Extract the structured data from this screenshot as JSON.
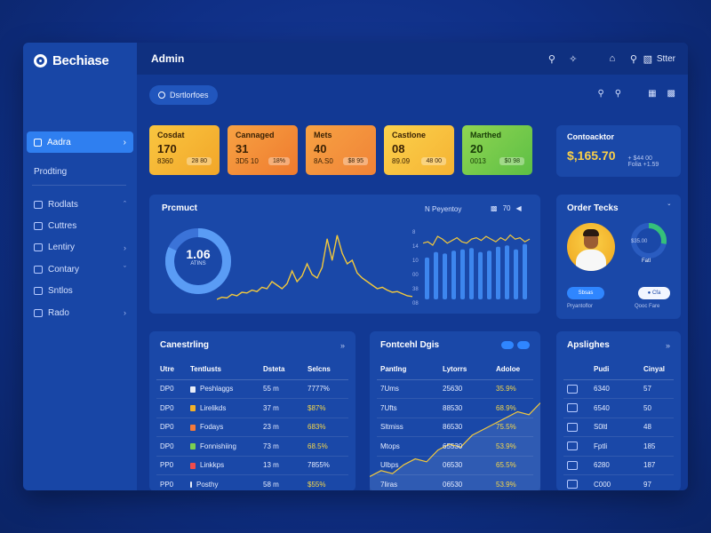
{
  "app": {
    "brand": "Bechiase",
    "title": "Admin"
  },
  "header": {
    "tools": [
      "search-icon",
      "sparkle-icon",
      "home-icon",
      "search-icon"
    ],
    "user": "Stter"
  },
  "sidebar": {
    "active": "Aadra",
    "plain": "Prodting",
    "items": [
      {
        "label": "Rodlats",
        "icon": "box-icon"
      },
      {
        "label": "Cuttres",
        "icon": "grid-icon"
      },
      {
        "label": "Lentiry",
        "icon": "list-icon"
      },
      {
        "label": "Contary",
        "icon": "chat-icon"
      },
      {
        "label": "Sntlos",
        "icon": "settings-icon"
      },
      {
        "label": "Rado",
        "icon": "shield-icon"
      }
    ]
  },
  "subheader": {
    "pill": "Dsrtlorfoes"
  },
  "stats": [
    {
      "name": "Cosdat",
      "value": "170",
      "sub": "8360",
      "chip": "28 80"
    },
    {
      "name": "Cannaged",
      "value": "31",
      "sub": "3D5 10",
      "chip": "18%"
    },
    {
      "name": "Mets",
      "value": "40",
      "sub": "8A.S0",
      "chip": "$8 95"
    },
    {
      "name": "Castlone",
      "value": "08",
      "sub": "89.09",
      "chip": "48 00"
    },
    {
      "name": "Marthed",
      "value": "20",
      "sub": "0013",
      "chip": "$0 98"
    }
  ],
  "conversion": {
    "title": "Contoacktor",
    "value": "$,165.70",
    "note1": "+ $44 00",
    "note2": "Folia  +1.59"
  },
  "product": {
    "title": "Prcmuct",
    "donut": {
      "value": "1.06",
      "label": "ATINS",
      "fraction": 0.82
    },
    "bars_title": "N Peyentoy",
    "bars_badge": "70",
    "axis": [
      "8",
      "14",
      "10",
      "00",
      "38",
      "08"
    ]
  },
  "orders": {
    "title": "Order Tecks",
    "label1": "$35.00",
    "label2": "Fatl",
    "btn1": "Sbsas",
    "btn2": "Cfa",
    "foot1": "Pryantoflor",
    "foot2": "Qooc Fare"
  },
  "table1": {
    "title": "Canestrling",
    "headers": [
      "Utre",
      "Tentlusts",
      "Dsteta",
      "Selcns"
    ],
    "rows": [
      [
        "DP0",
        "Peshlaggs",
        "55 m",
        "7777%"
      ],
      [
        "DP0",
        "Lirelikds",
        "37 m",
        "$87%"
      ],
      [
        "DP0",
        "Fodays",
        "23 m",
        "683%"
      ],
      [
        "DP0",
        "Fonnishiing",
        "73 m",
        "68.5%"
      ],
      [
        "PP0",
        "Linkkps",
        "13 m",
        "7855%"
      ],
      [
        "PP0",
        "Posthy",
        "58 m",
        "$55%"
      ]
    ]
  },
  "table2": {
    "title": "Fontcehl Dgis",
    "headers": [
      "Pantlng",
      "Lytorrs",
      "Adoloe"
    ],
    "rows": [
      [
        "7Ums",
        "25630",
        "35.9%"
      ],
      [
        "7Ufts",
        "88530",
        "68.9%"
      ],
      [
        "Sltmiss",
        "86530",
        "75.5%"
      ],
      [
        "Mtops",
        "65530",
        "53.9%"
      ],
      [
        "Ulbps",
        "06530",
        "65.5%"
      ],
      [
        "7liras",
        "06530",
        "53.9%"
      ]
    ]
  },
  "table3": {
    "title": "Apslighes",
    "headers": [
      "",
      "Pudi",
      "Cinyal"
    ],
    "rows": [
      [
        "",
        "6340",
        "57"
      ],
      [
        "",
        "6540",
        "50"
      ],
      [
        "",
        "S0ltl",
        "48"
      ],
      [
        "",
        "Fptli",
        "185"
      ],
      [
        "",
        "6280",
        "187"
      ],
      [
        "",
        "C000",
        "97"
      ]
    ]
  },
  "chart_data": [
    {
      "type": "line",
      "x": [
        0,
        1,
        2,
        3,
        4,
        5,
        6,
        7,
        8,
        9,
        10,
        11,
        12,
        13,
        14,
        15,
        16,
        17,
        18,
        19,
        20,
        21,
        22,
        23,
        24,
        25,
        26,
        27,
        28,
        29,
        30,
        31,
        32,
        33,
        34,
        35,
        36,
        37,
        38,
        39
      ],
      "values": [
        5,
        8,
        7,
        12,
        10,
        15,
        14,
        18,
        16,
        22,
        20,
        30,
        25,
        20,
        27,
        45,
        30,
        38,
        55,
        40,
        35,
        50,
        90,
        60,
        95,
        70,
        55,
        60,
        42,
        35,
        30,
        25,
        20,
        22,
        18,
        15,
        16,
        13,
        10,
        9
      ],
      "ylim": [
        0,
        100
      ]
    },
    {
      "type": "bar",
      "values": [
        62,
        70,
        68,
        72,
        74,
        76,
        70,
        72,
        78,
        80,
        74,
        82
      ],
      "line": [
        78,
        80,
        75,
        88,
        84,
        78,
        82,
        86,
        80,
        78,
        84,
        86,
        82,
        88,
        84,
        80,
        86,
        82,
        90,
        84,
        86,
        80,
        84
      ],
      "ylim": [
        0,
        100
      ]
    },
    {
      "type": "area",
      "values": [
        10,
        14,
        12,
        18,
        22,
        20,
        28,
        32,
        30,
        38,
        42,
        46,
        50,
        54,
        52,
        60
      ],
      "ylim": [
        0,
        70
      ]
    }
  ]
}
